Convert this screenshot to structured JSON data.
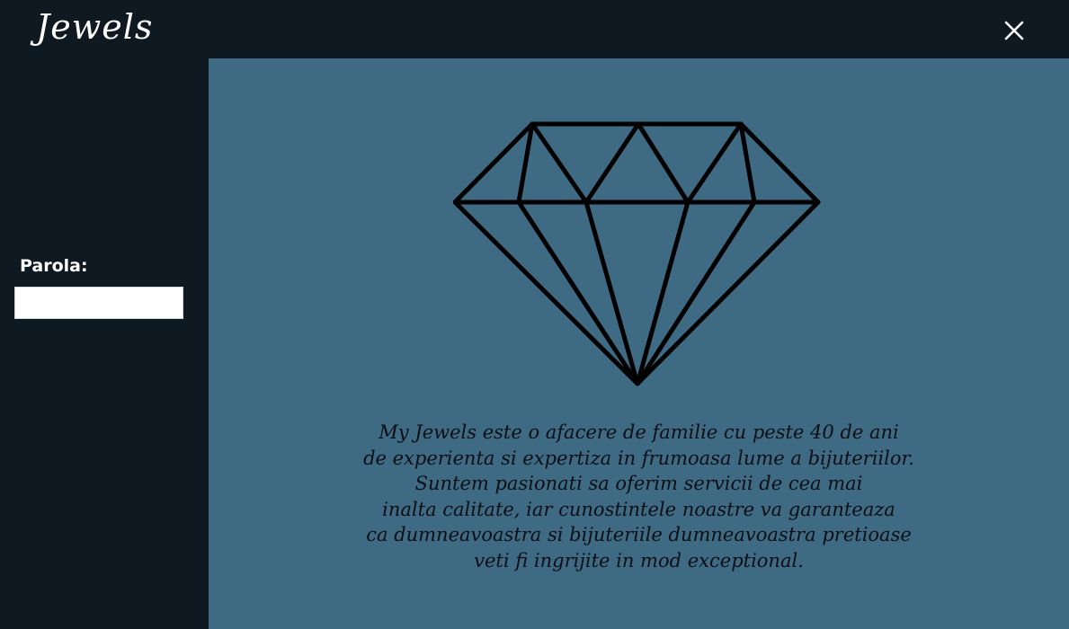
{
  "app": {
    "brand": "Jewels",
    "close_symbol": "✕",
    "colors": {
      "background": "#0f1921",
      "main_panel": "#3e6a84",
      "text_light": "#ffffff",
      "text_dark": "#0b0f13"
    }
  },
  "sidebar": {
    "password_label": "Parola:",
    "password_value": ""
  },
  "main": {
    "icon": "diamond-icon",
    "about_lines": [
      "My Jewels este o afacere de familie cu peste 40 de ani",
      "de experienta si expertiza in frumoasa lume a bijuteriilor.",
      "Suntem pasionati sa oferim servicii de cea mai",
      "inalta calitate, iar cunostintele noastre va garanteaza",
      "ca dumneavoastra si bijuteriile dumneavoastra pretioase",
      "veti fi ingrijite in mod exceptional."
    ]
  }
}
